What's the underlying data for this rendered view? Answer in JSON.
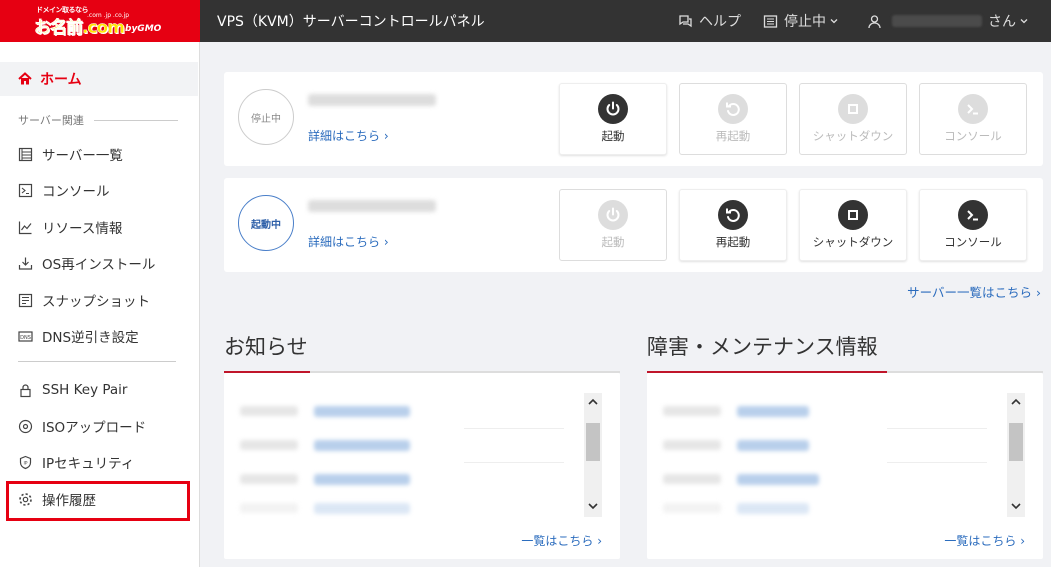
{
  "header": {
    "logo_tagline": "ドメイン取るなら",
    "logo_brand": "お名前.com",
    "logo_tlds": ".com .jp .co.jp",
    "logo_gmo": "byGMO",
    "title": "VPS（KVM）サーバーコントロールパネル",
    "help": "ヘルプ",
    "status": "停止中",
    "user_suffix": "さん"
  },
  "sidebar": {
    "home": "ホーム",
    "section": "サーバー関連",
    "items": [
      {
        "label": "サーバー一覧",
        "icon": "server-list-icon"
      },
      {
        "label": "コンソール",
        "icon": "console-icon"
      },
      {
        "label": "リソース情報",
        "icon": "resource-chart-icon"
      },
      {
        "label": "OS再インストール",
        "icon": "reinstall-icon"
      },
      {
        "label": "スナップショット",
        "icon": "snapshot-icon"
      },
      {
        "label": "DNS逆引き設定",
        "icon": "dns-icon"
      }
    ],
    "items2": [
      {
        "label": "SSH Key Pair",
        "icon": "lock-icon"
      },
      {
        "label": "ISOアップロード",
        "icon": "disc-icon"
      },
      {
        "label": "IPセキュリティ",
        "icon": "shield-icon"
      },
      {
        "label": "操作履歴",
        "icon": "gear-icon"
      }
    ]
  },
  "servers": [
    {
      "status": "停止中",
      "detail": "詳細はこちら ›",
      "buttons": [
        "起動",
        "再起動",
        "シャットダウン",
        "コンソール"
      ]
    },
    {
      "status": "起動中",
      "detail": "詳細はこちら ›",
      "buttons": [
        "起動",
        "再起動",
        "シャットダウン",
        "コンソール"
      ]
    }
  ],
  "more_servers": "サーバー一覧はこちら ›",
  "news": {
    "title": "お知らせ",
    "more": "一覧はこちら ›"
  },
  "maintenance": {
    "title": "障害・メンテナンス情報",
    "more": "一覧はこちら ›"
  },
  "colors": {
    "brand": "#e60012",
    "header_bg": "#333333",
    "link": "#2a6bbd"
  }
}
